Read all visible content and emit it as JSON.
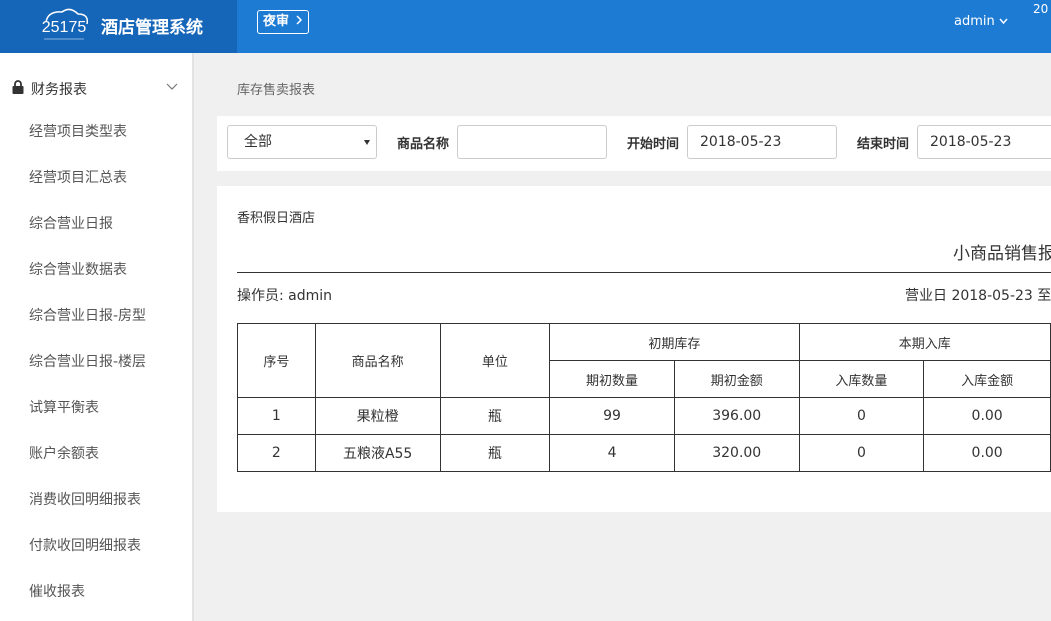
{
  "header": {
    "app_title": "酒店管理系统",
    "logo_text": "25175",
    "night_audit_label": "夜审",
    "user_label": "admin",
    "header_extra": "20"
  },
  "sidebar": {
    "group_label": "财务报表",
    "items": [
      {
        "label": "经营项目类型表"
      },
      {
        "label": "经营项目汇总表"
      },
      {
        "label": "综合营业日报"
      },
      {
        "label": "综合营业数据表"
      },
      {
        "label": "综合营业日报-房型"
      },
      {
        "label": "综合营业日报-楼层"
      },
      {
        "label": "试算平衡表"
      },
      {
        "label": "账户余额表"
      },
      {
        "label": "消费收回明细报表"
      },
      {
        "label": "付款收回明细报表"
      },
      {
        "label": "催收报表"
      }
    ]
  },
  "breadcrumb": "库存售卖报表",
  "filter": {
    "category_value": "全部",
    "product_name_label": "商品名称",
    "product_name_value": "",
    "start_label": "开始时间",
    "start_value": "2018-05-23",
    "end_label": "结束时间",
    "end_value": "2018-05-23"
  },
  "report": {
    "hotel_name": "香积假日酒店",
    "title": "小商品销售报",
    "operator": "操作员: admin",
    "business_day": "营业日 2018-05-23 至",
    "table": {
      "headers": {
        "seq": "序号",
        "name": "商品名称",
        "unit": "单位",
        "opening_group": "初期库存",
        "opening_qty": "期初数量",
        "opening_amount": "期初金额",
        "inbound_group": "本期入库",
        "inbound_qty": "入库数量",
        "inbound_amount": "入库金额"
      },
      "rows": [
        {
          "seq": "1",
          "name": "果粒橙",
          "unit": "瓶",
          "opening_qty": "99",
          "opening_amount": "396.00",
          "inbound_qty": "0",
          "inbound_amount": "0.00"
        },
        {
          "seq": "2",
          "name": "五粮液A55",
          "unit": "瓶",
          "opening_qty": "4",
          "opening_amount": "320.00",
          "inbound_qty": "0",
          "inbound_amount": "0.00"
        }
      ]
    }
  }
}
